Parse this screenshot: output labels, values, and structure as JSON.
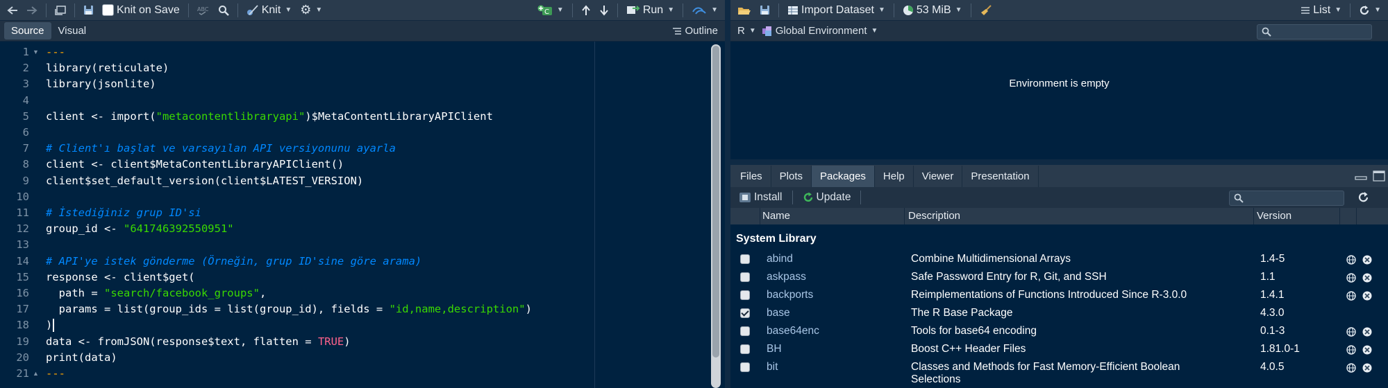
{
  "editor_toolbar": {
    "knit_on_save_label": "Knit on Save",
    "knit_label": "Knit",
    "run_label": "Run"
  },
  "editor_modes": {
    "source": "Source",
    "visual": "Visual",
    "outline": "Outline"
  },
  "code_lines": [
    {
      "n": "1"
    },
    {
      "n": "2"
    },
    {
      "n": "3"
    },
    {
      "n": "4"
    },
    {
      "n": "5"
    },
    {
      "n": "6"
    },
    {
      "n": "7"
    },
    {
      "n": "8"
    },
    {
      "n": "9"
    },
    {
      "n": "10"
    },
    {
      "n": "11"
    },
    {
      "n": "12"
    },
    {
      "n": "13"
    },
    {
      "n": "14"
    },
    {
      "n": "15"
    },
    {
      "n": "16"
    },
    {
      "n": "17"
    },
    {
      "n": "18"
    },
    {
      "n": "19"
    },
    {
      "n": "20"
    },
    {
      "n": "21"
    }
  ],
  "code": {
    "l1": "---",
    "l2": "library(reticulate)",
    "l3": "library(jsonlite)",
    "l5a": "client <- import(",
    "l5b": "\"metacontentlibraryapi\"",
    "l5c": ")$MetaContentLibraryAPIClient",
    "l7": "# Client'ı başlat ve varsayılan API versiyonunu ayarla",
    "l8": "client <- client$MetaContentLibraryAPIClient()",
    "l9": "client$set_default_version(client$LATEST_VERSION)",
    "l11": "# İstediğiniz grup ID'si",
    "l12a": "group_id <- ",
    "l12b": "\"641746392550951\"",
    "l14": "# API'ye istek gönderme (Örneğin, grup ID'sine göre arama)",
    "l15": "response <- client$get(",
    "l16a": "  path = ",
    "l16b": "\"search/facebook_groups\"",
    "l16c": ",",
    "l17a": "  params = list(group_ids = list(group_id), fields = ",
    "l17b": "\"id,name,description\"",
    "l17c": ")",
    "l18": ")",
    "l19a": "data <- fromJSON(response$text, flatten = ",
    "l19b": "TRUE",
    "l19c": ")",
    "l20": "print(data)",
    "l21": "---"
  },
  "env_toolbar": {
    "import_label": "Import Dataset",
    "memory_label": "53 MiB",
    "list_label": "List",
    "lang_label": "R",
    "env_label": "Global Environment"
  },
  "env_empty": "Environment is empty",
  "tabs": [
    "Files",
    "Plots",
    "Packages",
    "Help",
    "Viewer",
    "Presentation"
  ],
  "packages_toolbar": {
    "install": "Install",
    "update": "Update"
  },
  "packages_header": {
    "name": "Name",
    "description": "Description",
    "version": "Version"
  },
  "packages_group": "System Library",
  "packages": [
    {
      "name": "abind",
      "description": "Combine Multidimensional Arrays",
      "version": "1.4-5",
      "checked": false,
      "has_actions": true
    },
    {
      "name": "askpass",
      "description": "Safe Password Entry for R, Git, and SSH",
      "version": "1.1",
      "checked": false,
      "has_actions": true
    },
    {
      "name": "backports",
      "description": "Reimplementations of Functions Introduced Since R-3.0.0",
      "version": "1.4.1",
      "checked": false,
      "has_actions": true
    },
    {
      "name": "base",
      "description": "The R Base Package",
      "version": "4.3.0",
      "checked": true,
      "has_actions": false
    },
    {
      "name": "base64enc",
      "description": "Tools for base64 encoding",
      "version": "0.1-3",
      "checked": false,
      "has_actions": true
    },
    {
      "name": "BH",
      "description": "Boost C++ Header Files",
      "version": "1.81.0-1",
      "checked": false,
      "has_actions": true
    },
    {
      "name": "bit",
      "description": "Classes and Methods for Fast Memory-Efficient Boolean Selections",
      "version": "4.0.5",
      "checked": false,
      "has_actions": true
    }
  ]
}
